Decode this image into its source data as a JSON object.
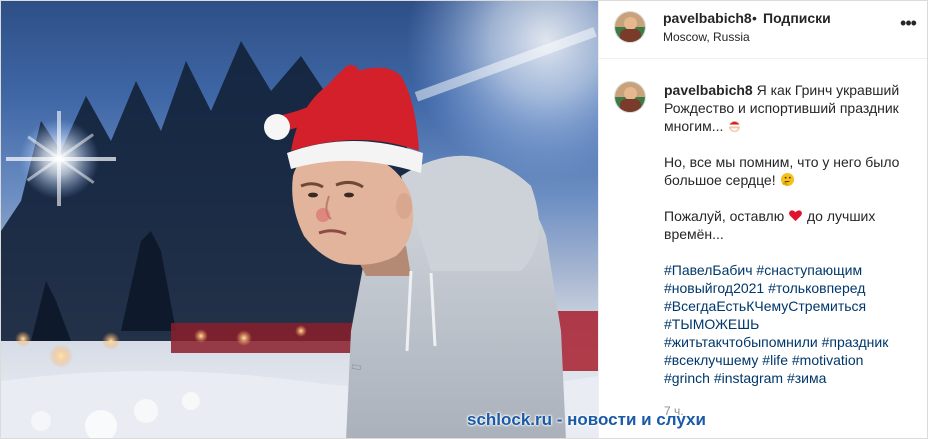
{
  "header": {
    "username": "pavelbabich8",
    "separator": "•",
    "follow_label": "Подписки",
    "location": "Moscow, Russia",
    "more_icon": "more-horizontal-icon"
  },
  "caption": {
    "username": "pavelbabich8",
    "line1": "Я как Гринч укравший Рождество и испортивший праздник многим...",
    "line2": "Но, все мы помним, что у него было большое сердце!",
    "line3_before": "Пожалуй, оставлю",
    "line3_after": "до лучших времён...",
    "emoji_1": "santa-emoji",
    "emoji_2": "thinking-face-emoji",
    "emoji_3": "red-heart-emoji",
    "hashtags": [
      "#ПавелБабич",
      "#снаступающим",
      "#новыйгод2021",
      "#тольковперед",
      "#ВсегдаЕстьКЧемуСтремиться",
      "#ТЫМОЖЕШЬ",
      "#житьтакчтобыпомнили",
      "#праздник",
      "#всеклучшему",
      "#life",
      "#motivation",
      "#grinch",
      "#instagram",
      "#зима"
    ]
  },
  "timestamp": "7 ч.",
  "watermark": "schlock.ru - новости и слухи",
  "colors": {
    "hashtag": "#00376b",
    "text": "#262626",
    "muted": "#8e8e8e",
    "santa_hat": "#d4202a",
    "hoodie": "#c9ced6",
    "watermark": "#1a5aa6"
  }
}
